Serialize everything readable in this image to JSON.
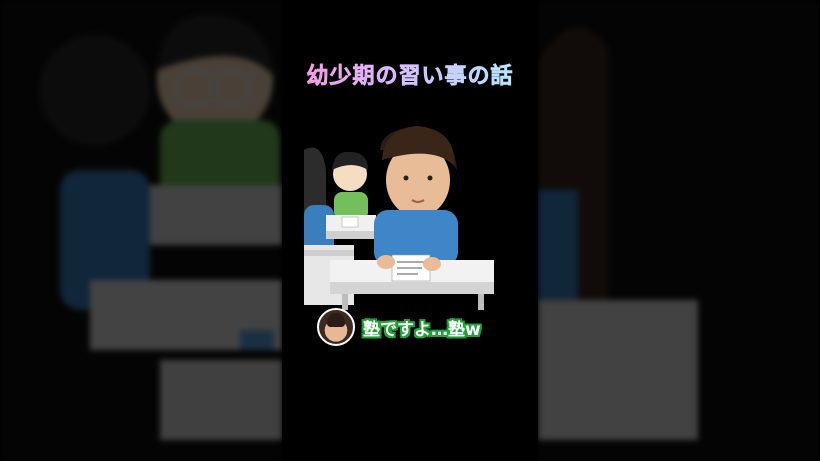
{
  "video": {
    "title": "幼少期の習い事の話",
    "subtitle": "塾ですよ…塾w"
  },
  "colors": {
    "title_gradient": [
      "#ff5fd1",
      "#c69bff",
      "#7fe8ff"
    ],
    "subtitle_outline": "#22a33a",
    "background": "#000000"
  },
  "icons": {
    "speaker_avatar": "person-avatar-icon"
  }
}
